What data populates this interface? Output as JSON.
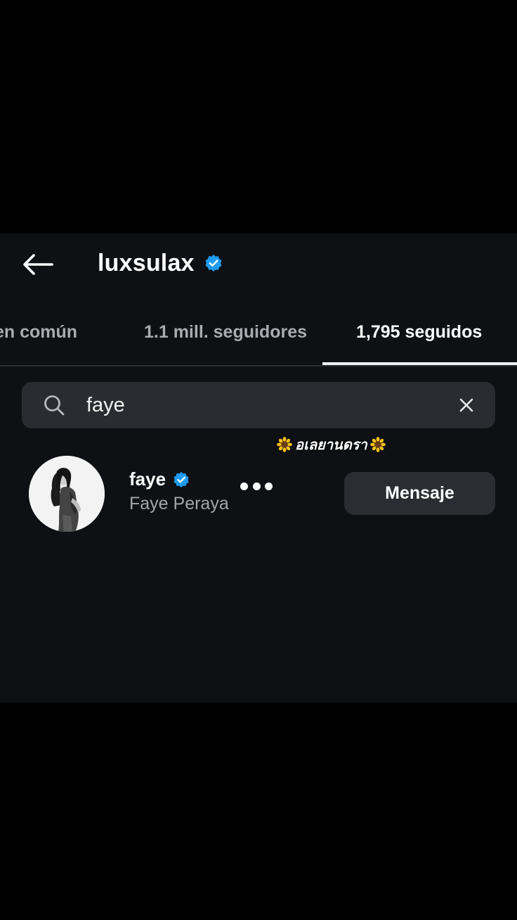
{
  "header": {
    "title": "luxsulax",
    "verified": true,
    "back_icon": "arrow-left-icon",
    "verified_icon": "verified-badge-icon"
  },
  "tabs": [
    {
      "label": "en común",
      "active": false
    },
    {
      "label": "1.1 mill. seguidores",
      "active": false
    },
    {
      "label": "1,795 seguidos",
      "active": true
    }
  ],
  "search": {
    "value": "faye",
    "search_icon": "search-icon",
    "clear_icon": "close-icon"
  },
  "overlay_caption": {
    "text": "อเลยานดรา",
    "icon": "sunflower-icon"
  },
  "results": [
    {
      "username": "faye",
      "full_name": "Faye Peraya",
      "verified": true,
      "more_icon": "more-horizontal-icon",
      "action_label": "Mensaje"
    }
  ],
  "colors": {
    "background": "#0e1013",
    "letterbox": "#000000",
    "verified_blue": "#1d9bf0",
    "button_bg": "#2b2d32",
    "search_bg": "#2a2c31",
    "muted_text": "#a8abb0"
  }
}
